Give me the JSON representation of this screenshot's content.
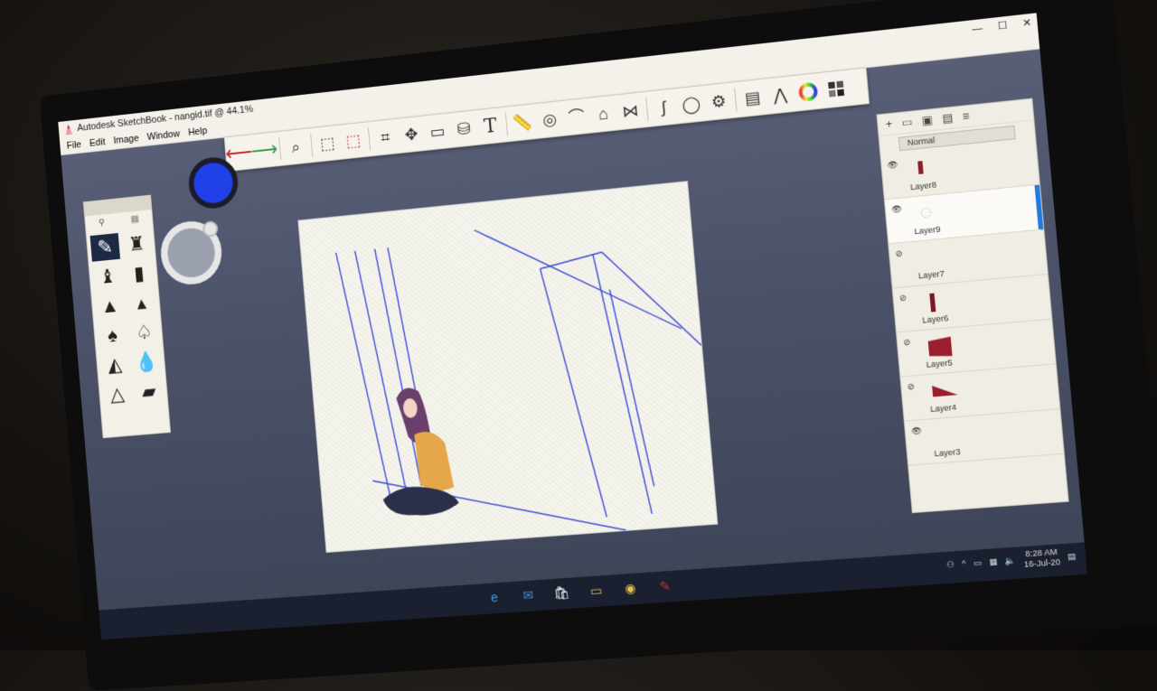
{
  "window": {
    "title": "Autodesk SketchBook - nangid.tif @ 44.1%",
    "controls": [
      "—",
      "☐",
      "✕"
    ]
  },
  "menu": [
    "File",
    "Edit",
    "Image",
    "Window",
    "Help"
  ],
  "toolbar": {
    "tools": [
      "undo-icon",
      "redo-icon",
      "magnifier-icon",
      "select-icon",
      "select-delete-icon",
      "crop-icon",
      "transform-icon",
      "rectangle-icon",
      "cylinder-icon",
      "text-icon",
      "ruler-icon",
      "ellipse-guide-icon",
      "french-curve-icon",
      "perspective-icon",
      "symmetry-icon",
      "stroke-icon",
      "shape-icon",
      "fill-icon",
      "copic-library-icon",
      "brush-library-icon",
      "color-wheel-icon",
      "swatches-icon"
    ],
    "text_tool_glyph": "T"
  },
  "colors": {
    "current_color": "#2040e8",
    "accent": "#1f7be0"
  },
  "layers": {
    "blend_mode": "Normal",
    "items": [
      {
        "name": "Layer8",
        "selected": false,
        "thumb_color": "#8c1f2a"
      },
      {
        "name": "Layer9",
        "selected": true,
        "thumb_color": ""
      },
      {
        "name": "Layer7",
        "selected": false,
        "thumb_color": ""
      },
      {
        "name": "Layer6",
        "selected": false,
        "thumb_color": "#7a1a25"
      },
      {
        "name": "Layer5",
        "selected": false,
        "thumb_color": "#9a1e2e"
      },
      {
        "name": "Layer4",
        "selected": false,
        "thumb_color": "#9a1e2e"
      },
      {
        "name": "Layer3",
        "selected": false,
        "thumb_color": ""
      }
    ]
  },
  "taskbar": {
    "time": "8:28 AM",
    "date": "16-Jul-20"
  }
}
